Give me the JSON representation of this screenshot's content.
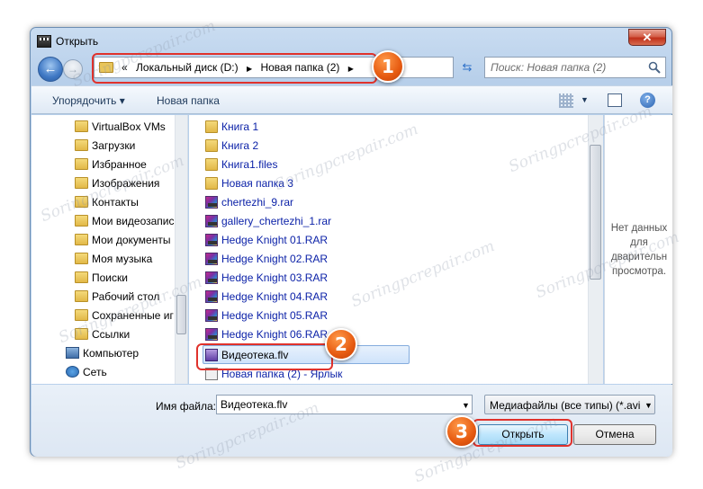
{
  "window": {
    "title": "Открыть",
    "close_glyph": "✕"
  },
  "address_bar": {
    "chevron": "«",
    "segments": [
      "Локальный диск (D:)",
      "Новая папка (2)"
    ],
    "separator": "▶"
  },
  "search": {
    "placeholder": "Поиск: Новая папка (2)"
  },
  "toolbar": {
    "organize": "Упорядочить ▾",
    "new_folder": "Новая папка",
    "help": "?"
  },
  "nav_pane": {
    "items": [
      {
        "label": "VirtualBox VMs",
        "icon": "folder-icon"
      },
      {
        "label": "Загрузки",
        "icon": "folder-icon"
      },
      {
        "label": "Избранное",
        "icon": "folder-icon"
      },
      {
        "label": "Изображения",
        "icon": "folder-icon"
      },
      {
        "label": "Контакты",
        "icon": "folder-icon"
      },
      {
        "label": "Мои видеозапис",
        "icon": "folder-icon"
      },
      {
        "label": "Мои документы",
        "icon": "folder-icon"
      },
      {
        "label": "Моя музыка",
        "icon": "folder-icon"
      },
      {
        "label": "Поиски",
        "icon": "folder-icon"
      },
      {
        "label": "Рабочий стол",
        "icon": "folder-icon"
      },
      {
        "label": "Сохраненные иг",
        "icon": "folder-icon"
      },
      {
        "label": "Ссылки",
        "icon": "folder-icon"
      },
      {
        "label": "Компьютер",
        "icon": "computer-icon"
      },
      {
        "label": "Сеть",
        "icon": "network-icon"
      }
    ]
  },
  "files": {
    "items": [
      {
        "label": "Книга 1",
        "icon": "folder-icon"
      },
      {
        "label": "Книга 2",
        "icon": "folder-icon"
      },
      {
        "label": "Книга1.files",
        "icon": "folder-icon"
      },
      {
        "label": "Новая папка 3",
        "icon": "folder-icon"
      },
      {
        "label": "chertezhi_9.rar",
        "icon": "rar-icon"
      },
      {
        "label": "gallery_chertezhi_1.rar",
        "icon": "rar-icon"
      },
      {
        "label": "Hedge Knight 01.RAR",
        "icon": "rar-icon"
      },
      {
        "label": "Hedge Knight 02.RAR",
        "icon": "rar-icon"
      },
      {
        "label": "Hedge Knight 03.RAR",
        "icon": "rar-icon"
      },
      {
        "label": "Hedge Knight 04.RAR",
        "icon": "rar-icon"
      },
      {
        "label": "Hedge Knight 05.RAR",
        "icon": "rar-icon"
      },
      {
        "label": "Hedge Knight 06.RAR",
        "icon": "rar-icon"
      },
      {
        "label": "Видеотека.flv",
        "icon": "flv-icon",
        "selected": true
      },
      {
        "label": "Новая папка (2) - Ярлык",
        "icon": "shortcut-icon"
      }
    ]
  },
  "preview": {
    "text": "Нет данных для дварительн просмотра."
  },
  "bottom": {
    "filename_label": "Имя файла:",
    "filename_value": "Видеотека.flv",
    "filetype_value": "Медиафайлы (все типы) (*.avi",
    "open_label": "Открыть",
    "cancel_label": "Отмена"
  },
  "callouts": {
    "one": "1",
    "two": "2",
    "three": "3"
  },
  "watermark": "Soringpcrepair.com",
  "colors": {
    "highlight": "#e0322c",
    "badge": "#e65a10",
    "link_text": "#0c22a8"
  }
}
